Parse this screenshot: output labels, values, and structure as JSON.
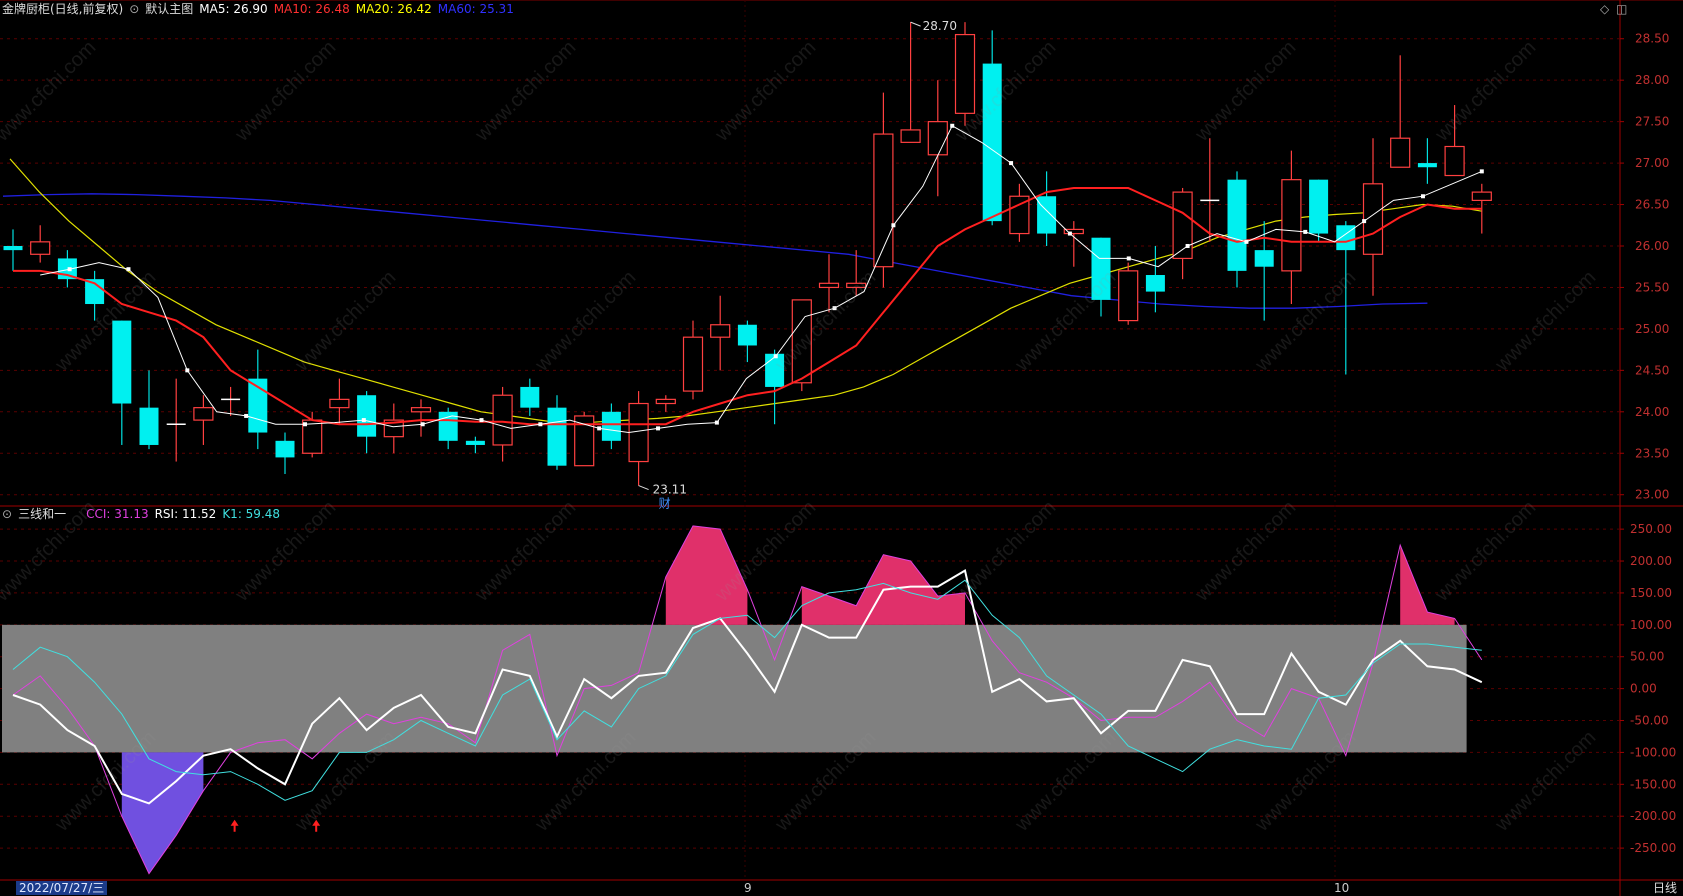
{
  "main_panel": {
    "title": "金牌厨柜(日线,前复权)",
    "indicator_name": "默认主图",
    "ma_labels": [
      {
        "text": "MA5: 26.90",
        "color": "#ffffff"
      },
      {
        "text": "MA10: 26.48",
        "color": "#ff3030"
      },
      {
        "text": "MA20: 26.42",
        "color": "#ffff00"
      },
      {
        "text": "MA60: 25.31",
        "color": "#2020ff"
      }
    ],
    "high_label": "28.70",
    "low_label": "23.11",
    "finance_marker": "财"
  },
  "sub_panel": {
    "title": "三线和一",
    "labels": [
      {
        "text": "CCI: 31.13",
        "color": "#e040e0"
      },
      {
        "text": "RSI: 11.52",
        "color": "#ffffff"
      },
      {
        "text": "K1: 59.48",
        "color": "#40e0e0"
      }
    ]
  },
  "footer": {
    "date": "2022/07/27/三",
    "month_labels": [
      "9",
      "10"
    ],
    "period": "日线"
  },
  "watermark": "www.cfchi.com",
  "icons": {
    "top_right": [
      "diamond-icon",
      "window-icon"
    ],
    "collapse": "chevron-circle-icon"
  },
  "chart_data": [
    {
      "type": "candlestick",
      "title": "金牌厨柜(日线,前复权)",
      "ylim": [
        22.9,
        28.75
      ],
      "y_ticks": [
        "28.50",
        "28.00",
        "27.50",
        "27.00",
        "26.50",
        "26.00",
        "25.50",
        "25.00",
        "24.50",
        "24.00",
        "23.50",
        "23.00"
      ],
      "candles": [
        {
          "o": 26.0,
          "c": 25.95,
          "h": 26.2,
          "l": 25.7
        },
        {
          "o": 25.9,
          "c": 26.05,
          "h": 26.25,
          "l": 25.8
        },
        {
          "o": 25.85,
          "c": 25.6,
          "h": 25.95,
          "l": 25.5
        },
        {
          "o": 25.6,
          "c": 25.3,
          "h": 25.7,
          "l": 25.1
        },
        {
          "o": 25.1,
          "c": 24.1,
          "h": 25.1,
          "l": 23.6
        },
        {
          "o": 24.05,
          "c": 23.6,
          "h": 24.5,
          "l": 23.55
        },
        {
          "o": 23.85,
          "c": 23.85,
          "h": 24.4,
          "l": 23.4
        },
        {
          "o": 23.9,
          "c": 24.05,
          "h": 24.2,
          "l": 23.6
        },
        {
          "o": 24.15,
          "c": 24.15,
          "h": 24.3,
          "l": 23.95
        },
        {
          "o": 24.4,
          "c": 23.75,
          "h": 24.75,
          "l": 23.55
        },
        {
          "o": 23.65,
          "c": 23.45,
          "h": 23.75,
          "l": 23.25
        },
        {
          "o": 23.5,
          "c": 23.9,
          "h": 24.0,
          "l": 23.45
        },
        {
          "o": 24.05,
          "c": 24.15,
          "h": 24.4,
          "l": 23.85
        },
        {
          "o": 24.2,
          "c": 23.7,
          "h": 24.25,
          "l": 23.5
        },
        {
          "o": 23.7,
          "c": 23.9,
          "h": 24.1,
          "l": 23.5
        },
        {
          "o": 24.0,
          "c": 24.05,
          "h": 24.15,
          "l": 23.7
        },
        {
          "o": 24.0,
          "c": 23.65,
          "h": 24.05,
          "l": 23.55
        },
        {
          "o": 23.65,
          "c": 23.6,
          "h": 23.7,
          "l": 23.5
        },
        {
          "o": 23.6,
          "c": 24.2,
          "h": 24.3,
          "l": 23.4
        },
        {
          "o": 24.3,
          "c": 24.05,
          "h": 24.4,
          "l": 23.95
        },
        {
          "o": 24.05,
          "c": 23.35,
          "h": 24.2,
          "l": 23.3
        },
        {
          "o": 23.35,
          "c": 23.95,
          "h": 24.0,
          "l": 23.35
        },
        {
          "o": 24.0,
          "c": 23.65,
          "h": 24.1,
          "l": 23.55
        },
        {
          "o": 23.4,
          "c": 24.1,
          "h": 24.25,
          "l": 23.11
        },
        {
          "o": 24.1,
          "c": 24.15,
          "h": 24.2,
          "l": 24.0
        },
        {
          "o": 24.25,
          "c": 24.9,
          "h": 25.1,
          "l": 24.15
        },
        {
          "o": 24.9,
          "c": 25.05,
          "h": 25.4,
          "l": 24.5
        },
        {
          "o": 25.05,
          "c": 24.8,
          "h": 25.1,
          "l": 24.6
        },
        {
          "o": 24.7,
          "c": 24.3,
          "h": 24.75,
          "l": 23.85
        },
        {
          "o": 24.35,
          "c": 25.35,
          "h": 25.35,
          "l": 24.25
        },
        {
          "o": 25.5,
          "c": 25.55,
          "h": 25.9,
          "l": 25.2
        },
        {
          "o": 25.5,
          "c": 25.55,
          "h": 25.95,
          "l": 25.4
        },
        {
          "o": 25.75,
          "c": 27.35,
          "h": 27.85,
          "l": 25.5
        },
        {
          "o": 27.25,
          "c": 27.4,
          "h": 28.7,
          "l": 27.25
        },
        {
          "o": 27.1,
          "c": 27.5,
          "h": 28.0,
          "l": 26.6
        },
        {
          "o": 27.6,
          "c": 28.55,
          "h": 28.7,
          "l": 27.45
        },
        {
          "o": 28.2,
          "c": 26.3,
          "h": 28.6,
          "l": 26.25
        },
        {
          "o": 26.15,
          "c": 26.6,
          "h": 26.75,
          "l": 26.05
        },
        {
          "o": 26.6,
          "c": 26.15,
          "h": 26.9,
          "l": 26.0
        },
        {
          "o": 26.15,
          "c": 26.2,
          "h": 26.3,
          "l": 25.75
        },
        {
          "o": 26.1,
          "c": 25.35,
          "h": 26.1,
          "l": 25.15
        },
        {
          "o": 25.1,
          "c": 25.7,
          "h": 25.8,
          "l": 25.05
        },
        {
          "o": 25.65,
          "c": 25.45,
          "h": 26.0,
          "l": 25.2
        },
        {
          "o": 25.85,
          "c": 26.65,
          "h": 26.7,
          "l": 25.6
        },
        {
          "o": 26.55,
          "c": 26.55,
          "h": 27.3,
          "l": 26.05
        },
        {
          "o": 26.8,
          "c": 25.7,
          "h": 26.9,
          "l": 25.5
        },
        {
          "o": 25.95,
          "c": 25.75,
          "h": 26.3,
          "l": 25.1
        },
        {
          "o": 25.7,
          "c": 26.8,
          "h": 27.15,
          "l": 25.3
        },
        {
          "o": 26.8,
          "c": 26.15,
          "h": 26.8,
          "l": 26.05
        },
        {
          "o": 26.25,
          "c": 25.95,
          "h": 26.3,
          "l": 24.45
        },
        {
          "o": 25.9,
          "c": 26.75,
          "h": 27.3,
          "l": 25.4
        },
        {
          "o": 26.95,
          "c": 27.3,
          "h": 28.3,
          "l": 26.95
        },
        {
          "o": 27.0,
          "c": 26.95,
          "h": 27.3,
          "l": 26.75
        },
        {
          "o": 26.85,
          "c": 27.2,
          "h": 27.7,
          "l": 26.85
        },
        {
          "o": 26.55,
          "c": 26.65,
          "h": 26.75,
          "l": 26.15
        }
      ],
      "ma5": [
        25.65,
        25.72,
        25.8,
        25.72,
        25.38,
        24.5,
        24.0,
        23.95,
        23.85,
        23.85,
        23.87,
        23.9,
        23.82,
        23.85,
        23.95,
        23.9,
        23.8,
        23.85,
        23.9,
        23.8,
        23.75,
        23.8,
        23.85,
        23.87,
        24.4,
        24.67,
        25.15,
        25.25,
        25.45,
        26.25,
        26.72,
        27.45,
        27.25,
        27.0,
        26.5,
        26.15,
        25.85,
        25.85,
        25.75,
        26.0,
        26.15,
        26.05,
        26.2,
        26.17,
        26.05,
        26.3,
        26.55,
        26.6,
        26.75,
        26.9
      ],
      "ma10": [
        25.7,
        25.7,
        25.65,
        25.55,
        25.3,
        25.2,
        25.1,
        24.9,
        24.5,
        24.3,
        24.1,
        23.9,
        23.85,
        23.85,
        23.87,
        23.9,
        23.9,
        23.88,
        23.88,
        23.85,
        23.85,
        23.85,
        23.85,
        23.85,
        23.85,
        24.0,
        24.1,
        24.2,
        24.25,
        24.4,
        24.6,
        24.8,
        25.2,
        25.6,
        26.0,
        26.2,
        26.35,
        26.5,
        26.65,
        26.7,
        26.7,
        26.7,
        26.55,
        26.4,
        26.15,
        26.05,
        26.1,
        26.05,
        26.05,
        26.05,
        26.15,
        26.35,
        26.5,
        26.45,
        26.45
      ],
      "ma20": [
        27.05,
        26.65,
        26.3,
        26.0,
        25.7,
        25.45,
        25.25,
        25.05,
        24.9,
        24.75,
        24.6,
        24.5,
        24.4,
        24.3,
        24.2,
        24.1,
        24.0,
        23.95,
        23.9,
        23.85,
        23.88,
        23.9,
        23.92,
        23.95,
        24.0,
        24.05,
        24.1,
        24.15,
        24.2,
        24.3,
        24.45,
        24.65,
        24.85,
        25.05,
        25.25,
        25.4,
        25.55,
        25.65,
        25.75,
        25.85,
        25.95,
        26.1,
        26.2,
        26.3,
        26.35,
        26.38,
        26.4,
        26.45,
        26.5,
        26.48,
        26.42
      ],
      "ma60": [
        26.6,
        26.62,
        26.63,
        26.62,
        26.6,
        26.58,
        26.55,
        26.5,
        26.45,
        26.4,
        26.35,
        26.3,
        26.25,
        26.2,
        26.15,
        26.1,
        26.05,
        26.0,
        25.95,
        25.9,
        25.8,
        25.7,
        25.6,
        25.5,
        25.4,
        25.35,
        25.3,
        25.27,
        25.25,
        25.25,
        25.27,
        25.3,
        25.31
      ]
    },
    {
      "type": "line",
      "title": "三线和一",
      "ylim": [
        -300,
        280
      ],
      "y_ticks": [
        "250.00",
        "200.00",
        "150.00",
        "100.00",
        "50.00",
        "0.00",
        "-50.00",
        "-100.00",
        "-150.00",
        "-200.00",
        "-250.00"
      ],
      "band": [
        -100,
        100
      ],
      "series": [
        {
          "name": "CCI",
          "color": "#e040e0",
          "values": [
            -10,
            20,
            -30,
            -90,
            -200,
            -290,
            -230,
            -160,
            -100,
            -85,
            -80,
            -110,
            -70,
            -40,
            -55,
            -45,
            -55,
            -85,
            60,
            85,
            -105,
            0,
            5,
            25,
            175,
            255,
            250,
            155,
            45,
            160,
            145,
            130,
            210,
            200,
            145,
            150,
            75,
            25,
            10,
            -15,
            -50,
            -45,
            -45,
            -20,
            10,
            -50,
            -75,
            0,
            -15,
            -105,
            40,
            225,
            120,
            110,
            45
          ]
        },
        {
          "name": "RSI",
          "color": "#ffffff",
          "values": [
            -10,
            -25,
            -65,
            -90,
            -165,
            -180,
            -145,
            -105,
            -95,
            -125,
            -150,
            -55,
            -15,
            -65,
            -30,
            -10,
            -60,
            -70,
            30,
            20,
            -75,
            15,
            -15,
            20,
            25,
            95,
            110,
            55,
            -5,
            100,
            80,
            80,
            155,
            160,
            160,
            185,
            -5,
            15,
            -20,
            -15,
            -70,
            -35,
            -35,
            45,
            35,
            -40,
            -40,
            55,
            -5,
            -25,
            45,
            75,
            35,
            30,
            10
          ]
        },
        {
          "name": "K1",
          "color": "#40e0e0",
          "values": [
            30,
            65,
            50,
            10,
            -40,
            -110,
            -130,
            -135,
            -130,
            -150,
            -175,
            -160,
            -100,
            -100,
            -80,
            -50,
            -70,
            -90,
            -10,
            15,
            -80,
            -35,
            -60,
            0,
            20,
            85,
            110,
            115,
            80,
            130,
            150,
            155,
            165,
            150,
            140,
            170,
            115,
            80,
            20,
            -10,
            -40,
            -90,
            -110,
            -130,
            -95,
            -80,
            -90,
            -95,
            -15,
            -10,
            40,
            70,
            70,
            65,
            60
          ]
        }
      ],
      "arrows_at": [
        8,
        11
      ]
    }
  ]
}
